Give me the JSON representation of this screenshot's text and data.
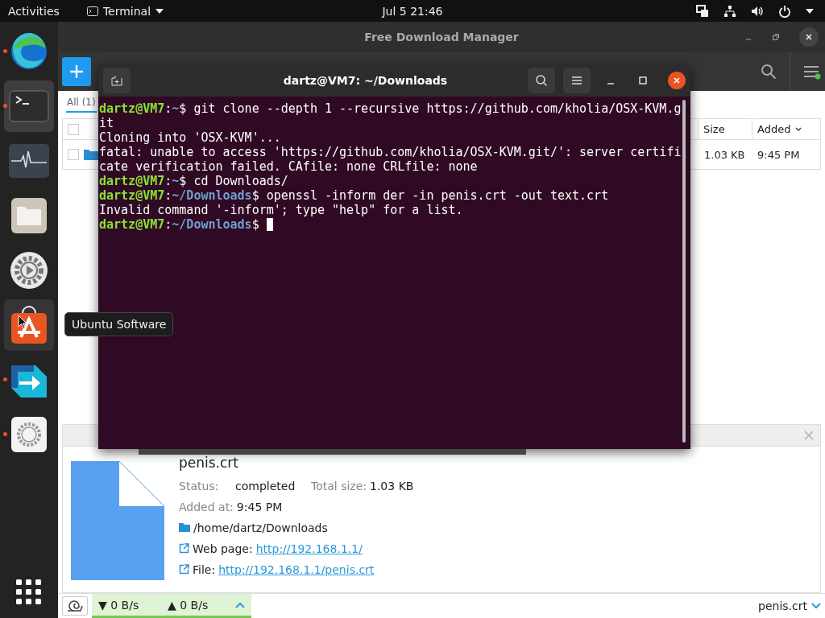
{
  "top_bar": {
    "activities": "Activities",
    "app_menu": "Terminal",
    "clock": "Jul 5  21:46"
  },
  "dock": {
    "items": [
      {
        "kind": "browser",
        "running": true,
        "focused": false,
        "hovered": false
      },
      {
        "kind": "terminal",
        "running": true,
        "focused": true,
        "hovered": false
      },
      {
        "kind": "system-monitor",
        "running": false,
        "focused": false,
        "hovered": false
      },
      {
        "kind": "files",
        "running": false,
        "focused": false,
        "hovered": false
      },
      {
        "kind": "media-settings",
        "running": false,
        "focused": false,
        "hovered": false
      },
      {
        "kind": "software",
        "running": false,
        "focused": false,
        "hovered": true
      },
      {
        "kind": "download-manager",
        "running": true,
        "focused": false,
        "hovered": false
      },
      {
        "kind": "settings",
        "running": true,
        "focused": false,
        "hovered": false
      }
    ],
    "tooltip": "Ubuntu Software"
  },
  "fdm": {
    "title": "Free Download Manager",
    "tabs": [
      {
        "label": "All (1)",
        "selected": true
      }
    ],
    "select_all_checked": false,
    "columns": [
      {
        "label": "Size",
        "sorted": false
      },
      {
        "label": "Added",
        "sorted": true
      }
    ],
    "rows": [
      {
        "checked": false,
        "size": "1.03 KB",
        "added": "9:45 PM"
      }
    ],
    "details": {
      "name": "penis.crt",
      "status_label": "Status:",
      "status": "completed",
      "total_size_label": "Total size:",
      "total_size": "1.03 KB",
      "added_label": "Added at:",
      "added": "9:45 PM",
      "folder": "/home/dartz/Downloads",
      "web_page_label": "Web page:",
      "web_page": "http://192.168.1.1/",
      "file_label": "File:",
      "file": "http://192.168.1.1/penis.crt"
    },
    "status_bar": {
      "download_speed": "▼ 0 B/s",
      "upload_speed": "▲ 0 B/s",
      "current_file": "penis.crt"
    }
  },
  "terminal": {
    "title": "dartz@VM7: ~/Downloads",
    "lines": [
      {
        "kind": "prompt",
        "user": "dartz@VM7",
        "sep": ":",
        "path": "~",
        "command": "$ git clone --depth 1 --recursive https://github.com/kholia/OSX-KVM.g",
        "cursor": false
      },
      {
        "kind": "output",
        "text": "it"
      },
      {
        "kind": "output",
        "text": "Cloning into 'OSX-KVM'..."
      },
      {
        "kind": "output",
        "text": "fatal: unable to access 'https://github.com/kholia/OSX-KVM.git/': server certifi"
      },
      {
        "kind": "output",
        "text": "cate verification failed. CAfile: none CRLfile: none"
      },
      {
        "kind": "prompt",
        "user": "dartz@VM7",
        "sep": ":",
        "path": "~",
        "command": "$ cd Downloads/",
        "cursor": false
      },
      {
        "kind": "prompt",
        "user": "dartz@VM7",
        "sep": ":",
        "path": "~/Downloads",
        "command": "$ openssl -inform der -in penis.crt -out text.crt",
        "cursor": false
      },
      {
        "kind": "output",
        "text": "Invalid command '-inform'; type \"help\" for a list."
      },
      {
        "kind": "prompt",
        "user": "dartz@VM7",
        "sep": ":",
        "path": "~/Downloads",
        "command": "$ ",
        "cursor": true
      }
    ]
  }
}
